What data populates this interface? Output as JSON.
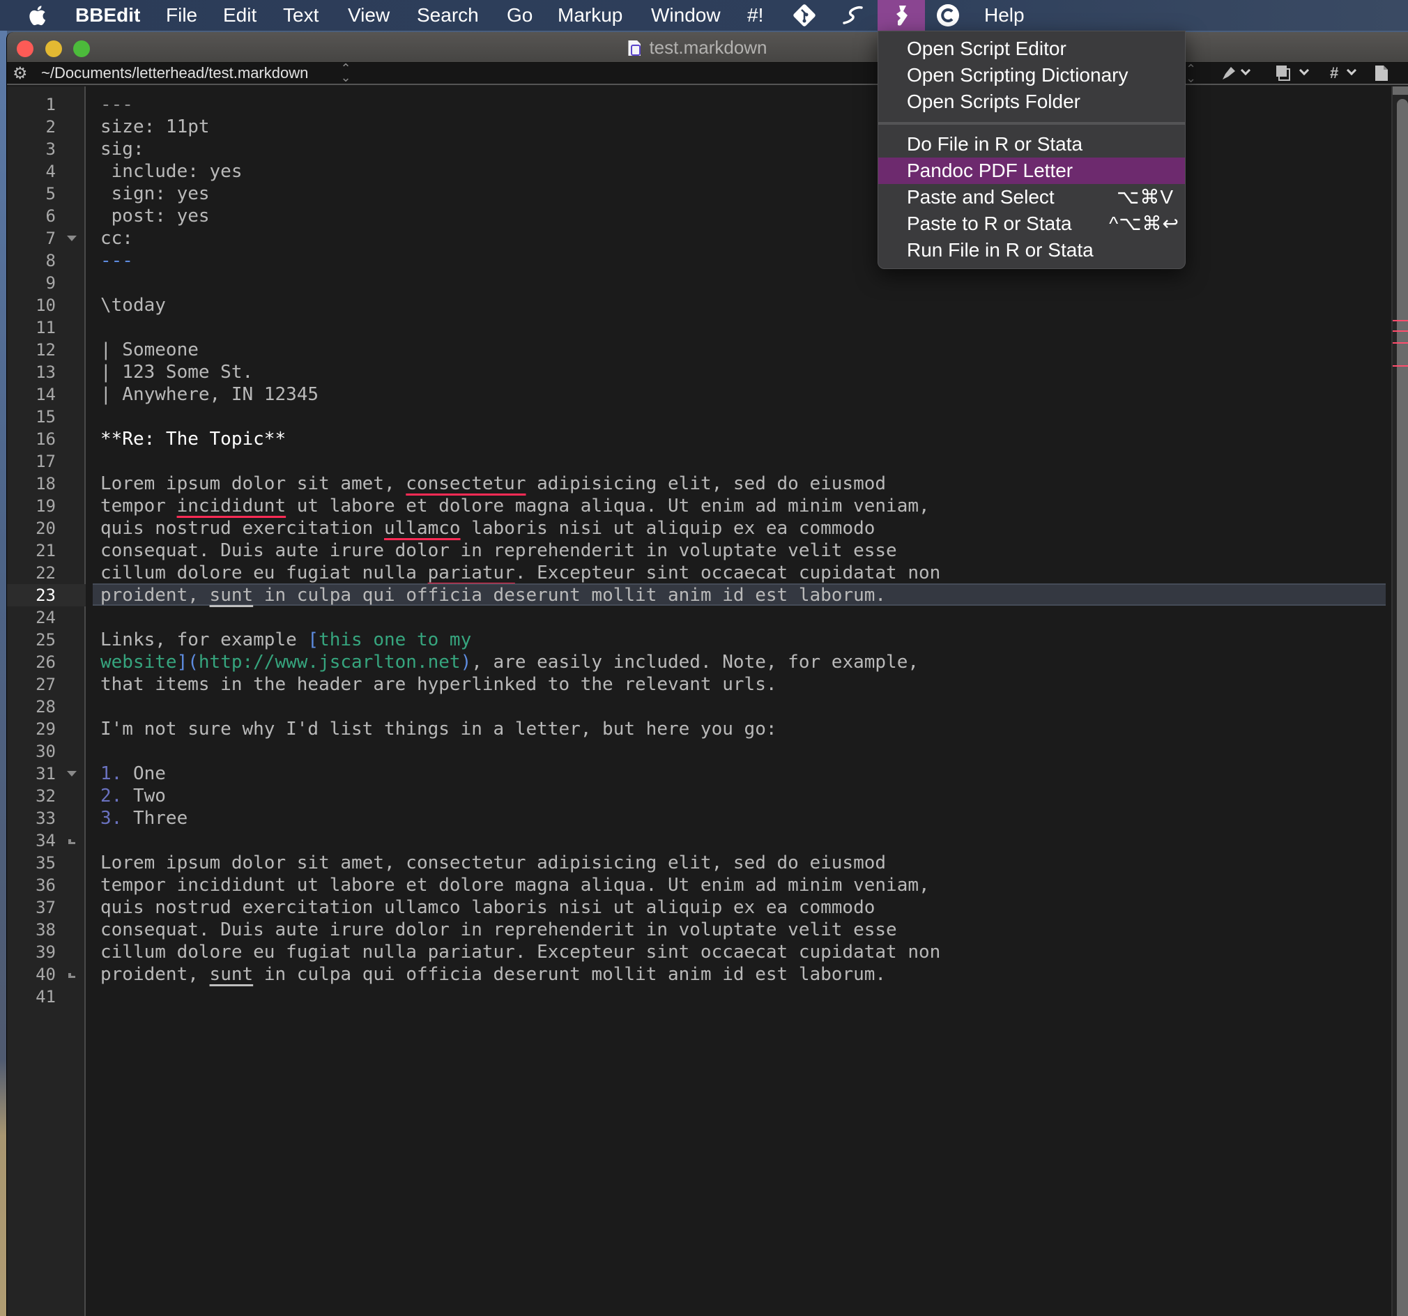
{
  "menubar": {
    "apple": "",
    "app": "BBEdit",
    "items": [
      "File",
      "Edit",
      "Text",
      "View",
      "Search",
      "Go",
      "Markup",
      "Window",
      "#!"
    ],
    "icons": [
      "git-icon",
      "scriptlet-icon",
      "scripts-icon",
      "c-icon"
    ],
    "help": "Help"
  },
  "window": {
    "title": "test.markdown",
    "path": "~/Documents/letterhead/test.markdown",
    "toolbar_icons": [
      "updown-icon",
      "marker-icon",
      "copy-icon",
      "hash-icon",
      "document-icon"
    ],
    "hash_label": "#"
  },
  "editor": {
    "current_line": 23,
    "line_numbers": [
      "1",
      "2",
      "3",
      "4",
      "5",
      "6",
      "7",
      "8",
      "9",
      "10",
      "11",
      "12",
      "13",
      "14",
      "15",
      "16",
      "17",
      "18",
      "19",
      "20",
      "21",
      "22",
      "23",
      "24",
      "25",
      "26",
      "27",
      "28",
      "29",
      "30",
      "31",
      "32",
      "33",
      "34",
      "35",
      "36",
      "37",
      "38",
      "39",
      "40",
      "41"
    ],
    "lines": [
      {
        "n": 1,
        "segs": [
          {
            "t": "---",
            "c": "dim"
          }
        ]
      },
      {
        "n": 2,
        "segs": [
          {
            "t": "size: 11pt"
          }
        ]
      },
      {
        "n": 3,
        "segs": [
          {
            "t": "sig:"
          }
        ]
      },
      {
        "n": 4,
        "segs": [
          {
            "t": " include: yes"
          }
        ]
      },
      {
        "n": 5,
        "segs": [
          {
            "t": " sign: yes"
          }
        ]
      },
      {
        "n": 6,
        "segs": [
          {
            "t": " post: yes"
          }
        ]
      },
      {
        "n": 7,
        "segs": [
          {
            "t": "cc:"
          }
        ],
        "fold": "open"
      },
      {
        "n": 8,
        "segs": [
          {
            "t": "---",
            "c": "blue"
          }
        ]
      },
      {
        "n": 9,
        "segs": []
      },
      {
        "n": 10,
        "segs": [
          {
            "t": "\\today"
          }
        ]
      },
      {
        "n": 11,
        "segs": []
      },
      {
        "n": 12,
        "segs": [
          {
            "t": "| Someone"
          }
        ]
      },
      {
        "n": 13,
        "segs": [
          {
            "t": "| 123 Some St."
          }
        ]
      },
      {
        "n": 14,
        "segs": [
          {
            "t": "| Anywhere, IN 12345"
          }
        ]
      },
      {
        "n": 15,
        "segs": []
      },
      {
        "n": 16,
        "segs": [
          {
            "t": "**Re: The Topic**",
            "c": "bold"
          }
        ]
      },
      {
        "n": 17,
        "segs": []
      },
      {
        "n": 18,
        "segs": [
          {
            "t": "Lorem ipsum dolor sit amet, "
          },
          {
            "t": "consectetur",
            "c": "spell"
          },
          {
            "t": " adipisicing elit, sed do eiusmod"
          }
        ]
      },
      {
        "n": 19,
        "segs": [
          {
            "t": "tempor "
          },
          {
            "t": "incididunt",
            "c": "spell"
          },
          {
            "t": " ut labore et dolore magna aliqua. Ut enim ad minim veniam,"
          }
        ]
      },
      {
        "n": 20,
        "segs": [
          {
            "t": "quis nostrud exercitation "
          },
          {
            "t": "ullamco",
            "c": "spell"
          },
          {
            "t": " laboris nisi ut aliquip ex ea commodo"
          }
        ]
      },
      {
        "n": 21,
        "segs": [
          {
            "t": "consequat. Duis aute irure dolor in reprehenderit in voluptate velit esse"
          }
        ]
      },
      {
        "n": 22,
        "segs": [
          {
            "t": "cillum dolore eu fugiat nulla "
          },
          {
            "t": "pariatur",
            "c": "spell"
          },
          {
            "t": ". Excepteur sint occaecat cupidatat non"
          }
        ]
      },
      {
        "n": 23,
        "segs": [
          {
            "t": "proident, "
          },
          {
            "t": "sunt",
            "c": "ulg"
          },
          {
            "t": " in culpa qui officia deserunt mollit anim id est laborum."
          }
        ]
      },
      {
        "n": 24,
        "segs": []
      },
      {
        "n": 25,
        "segs": [
          {
            "t": "Links, for example "
          },
          {
            "t": "[",
            "c": "blue"
          },
          {
            "t": "this one to my",
            "c": "green"
          }
        ]
      },
      {
        "n": 26,
        "segs": [
          {
            "t": "website",
            "c": "green"
          },
          {
            "t": "]",
            "c": "blue"
          },
          {
            "t": "(",
            "c": "blue"
          },
          {
            "t": "http://www.jscarlton.net",
            "c": "green"
          },
          {
            "t": ")",
            "c": "blue"
          },
          {
            "t": ", are easily included. Note, for example,"
          }
        ]
      },
      {
        "n": 27,
        "segs": [
          {
            "t": "that items in the header are hyperlinked to the relevant urls."
          }
        ]
      },
      {
        "n": 28,
        "segs": []
      },
      {
        "n": 29,
        "segs": [
          {
            "t": "I'm not sure why I'd list things in a letter, but here you go:"
          }
        ]
      },
      {
        "n": 30,
        "segs": []
      },
      {
        "n": 31,
        "segs": [
          {
            "t": "1.",
            "c": "lnum"
          },
          {
            "t": " One"
          }
        ],
        "fold": "open"
      },
      {
        "n": 32,
        "segs": [
          {
            "t": "2.",
            "c": "lnum"
          },
          {
            "t": " Two"
          }
        ]
      },
      {
        "n": 33,
        "segs": [
          {
            "t": "3.",
            "c": "lnum"
          },
          {
            "t": " Three"
          }
        ]
      },
      {
        "n": 34,
        "segs": [],
        "fold": "end"
      },
      {
        "n": 35,
        "segs": [
          {
            "t": "Lorem ipsum dolor sit amet, consectetur adipisicing elit, sed do eiusmod"
          }
        ]
      },
      {
        "n": 36,
        "segs": [
          {
            "t": "tempor incididunt ut labore et dolore magna aliqua. Ut enim ad minim veniam,"
          }
        ]
      },
      {
        "n": 37,
        "segs": [
          {
            "t": "quis nostrud exercitation ullamco laboris nisi ut aliquip ex ea commodo"
          }
        ]
      },
      {
        "n": 38,
        "segs": [
          {
            "t": "consequat. Duis aute irure dolor in reprehenderit in voluptate velit esse"
          }
        ]
      },
      {
        "n": 39,
        "segs": [
          {
            "t": "cillum dolore eu fugiat nulla pariatur. Excepteur sint occaecat cupidatat non"
          }
        ]
      },
      {
        "n": 40,
        "segs": [
          {
            "t": "proident, "
          },
          {
            "t": "sunt",
            "c": "ulg"
          },
          {
            "t": " in culpa qui officia deserunt mollit anim id est laborum."
          }
        ],
        "fold": "end"
      },
      {
        "n": 41,
        "segs": []
      }
    ]
  },
  "scripts_menu": {
    "group1": [
      "Open Script Editor",
      "Open Scripting Dictionary",
      "Open Scripts Folder"
    ],
    "group2": [
      {
        "label": "Do File in R or Stata",
        "shortcut": ""
      },
      {
        "label": "Pandoc PDF Letter",
        "shortcut": "",
        "highlighted": true
      },
      {
        "label": "Paste and Select",
        "shortcut": "⌥⌘V"
      },
      {
        "label": "Paste to R or Stata",
        "shortcut": "^⌥⌘↩"
      },
      {
        "label": "Run File in R or Stata",
        "shortcut": ""
      }
    ]
  },
  "colors": {
    "menubar_active": "#8a4591",
    "menu_highlight": "#6d2a6e",
    "spell_underline": "#ff2b55",
    "link_green": "#36a57e",
    "markup_blue": "#5e8ce0"
  }
}
